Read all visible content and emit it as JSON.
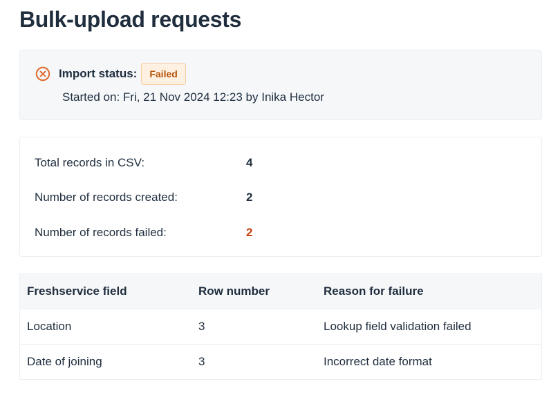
{
  "page": {
    "title": "Bulk-upload requests"
  },
  "import_status": {
    "icon": "x-circle-icon",
    "label": "Import status:",
    "badge": "Failed",
    "started_text": "Started on: Fri, 21 Nov 2024 12:23 by Inika Hector",
    "colors": {
      "icon": "#e0672a",
      "badge_bg": "#fff1e1",
      "badge_text": "#b45309"
    }
  },
  "summary": {
    "rows": [
      {
        "label": "Total records in CSV:",
        "value": "4"
      },
      {
        "label": "Number of records created:",
        "value": "2"
      },
      {
        "label": "Number of records failed:",
        "value": "2"
      }
    ],
    "failed_color": "#c2410c"
  },
  "failures": {
    "headers": [
      "Freshservice field",
      "Row number",
      "Reason for failure"
    ],
    "rows": [
      {
        "field": "Location",
        "row": "3",
        "reason": "Lookup field validation failed"
      },
      {
        "field": "Date of joining",
        "row": "3",
        "reason": "Incorrect date format"
      }
    ]
  }
}
